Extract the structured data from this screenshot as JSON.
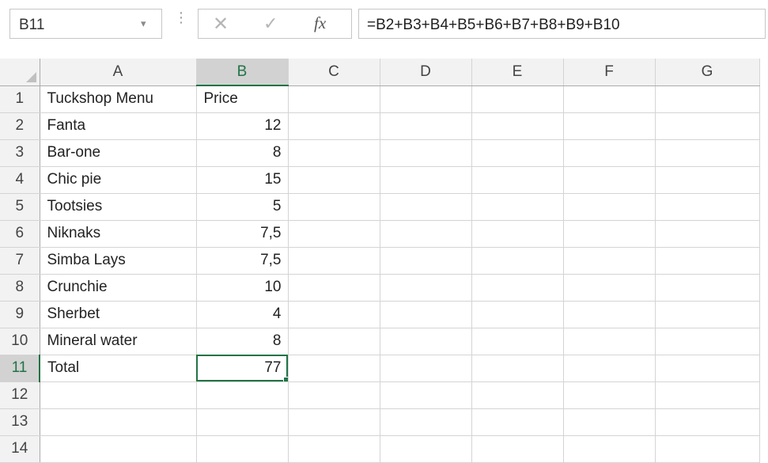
{
  "name_box": {
    "value": "B11",
    "dropdown_glyph": "▾"
  },
  "formula_bar": {
    "separator_glyph": "⋮",
    "cancel_glyph": "✕",
    "enter_glyph": "✓",
    "fx_label": "fx",
    "formula": "=B2+B3+B4+B5+B6+B7+B8+B9+B10"
  },
  "columns": [
    "A",
    "B",
    "C",
    "D",
    "E",
    "F",
    "G"
  ],
  "selected_column": "B",
  "selected_row": "11",
  "rows": [
    {
      "num": "1",
      "a": "Tuckshop Menu",
      "b": "Price"
    },
    {
      "num": "2",
      "a": "Fanta",
      "b": "12"
    },
    {
      "num": "3",
      "a": "Bar-one",
      "b": "8"
    },
    {
      "num": "4",
      "a": "Chic pie",
      "b": "15"
    },
    {
      "num": "5",
      "a": "Tootsies",
      "b": "5"
    },
    {
      "num": "6",
      "a": "Niknaks",
      "b": "7,5"
    },
    {
      "num": "7",
      "a": "Simba Lays",
      "b": "7,5"
    },
    {
      "num": "8",
      "a": "Crunchie",
      "b": "10"
    },
    {
      "num": "9",
      "a": "Sherbet",
      "b": "4"
    },
    {
      "num": "10",
      "a": "Mineral water",
      "b": "8"
    },
    {
      "num": "11",
      "a": "Total",
      "b": "77"
    },
    {
      "num": "12",
      "a": "",
      "b": ""
    },
    {
      "num": "13",
      "a": "",
      "b": ""
    },
    {
      "num": "14",
      "a": "",
      "b": ""
    }
  ],
  "colors": {
    "accent": "#217346",
    "header_bg": "#f2f2f2",
    "selected_header_bg": "#d2d2d2",
    "gridline": "#d4d4d4"
  },
  "icons": {
    "name_box_dropdown": "chevron-down-icon",
    "cancel": "close-icon",
    "enter": "checkmark-icon",
    "insert_function": "function-icon",
    "select_all": "select-all-icon"
  }
}
